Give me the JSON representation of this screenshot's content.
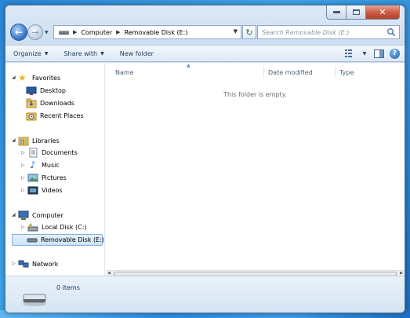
{
  "window": {
    "caption": {
      "minimize": "",
      "maximize": "",
      "close": "✕"
    }
  },
  "address_bar": {
    "crumbs": [
      "Computer",
      "Removable Disk (E:)"
    ],
    "search_placeholder": "Search Removable Disk (E:)"
  },
  "command_bar": {
    "organize": "Organize",
    "share_with": "Share with",
    "new_folder": "New folder"
  },
  "nav_tree": {
    "favorites": {
      "label": "Favorites",
      "items": [
        "Desktop",
        "Downloads",
        "Recent Places"
      ]
    },
    "libraries": {
      "label": "Libraries",
      "items": [
        "Documents",
        "Music",
        "Pictures",
        "Videos"
      ]
    },
    "computer": {
      "label": "Computer",
      "items": [
        "Local Disk (C:)",
        "Removable Disk (E:)"
      ]
    },
    "network": {
      "label": "Network"
    }
  },
  "columns": [
    "Name",
    "Date modified",
    "Type"
  ],
  "content": {
    "empty_message": "This folder is empty."
  },
  "details": {
    "items_count": "0 items"
  },
  "colors": {
    "selection_bg": "#cde4f9",
    "selection_border": "#84acdd",
    "annotation_arrow": "#e07b3c"
  }
}
